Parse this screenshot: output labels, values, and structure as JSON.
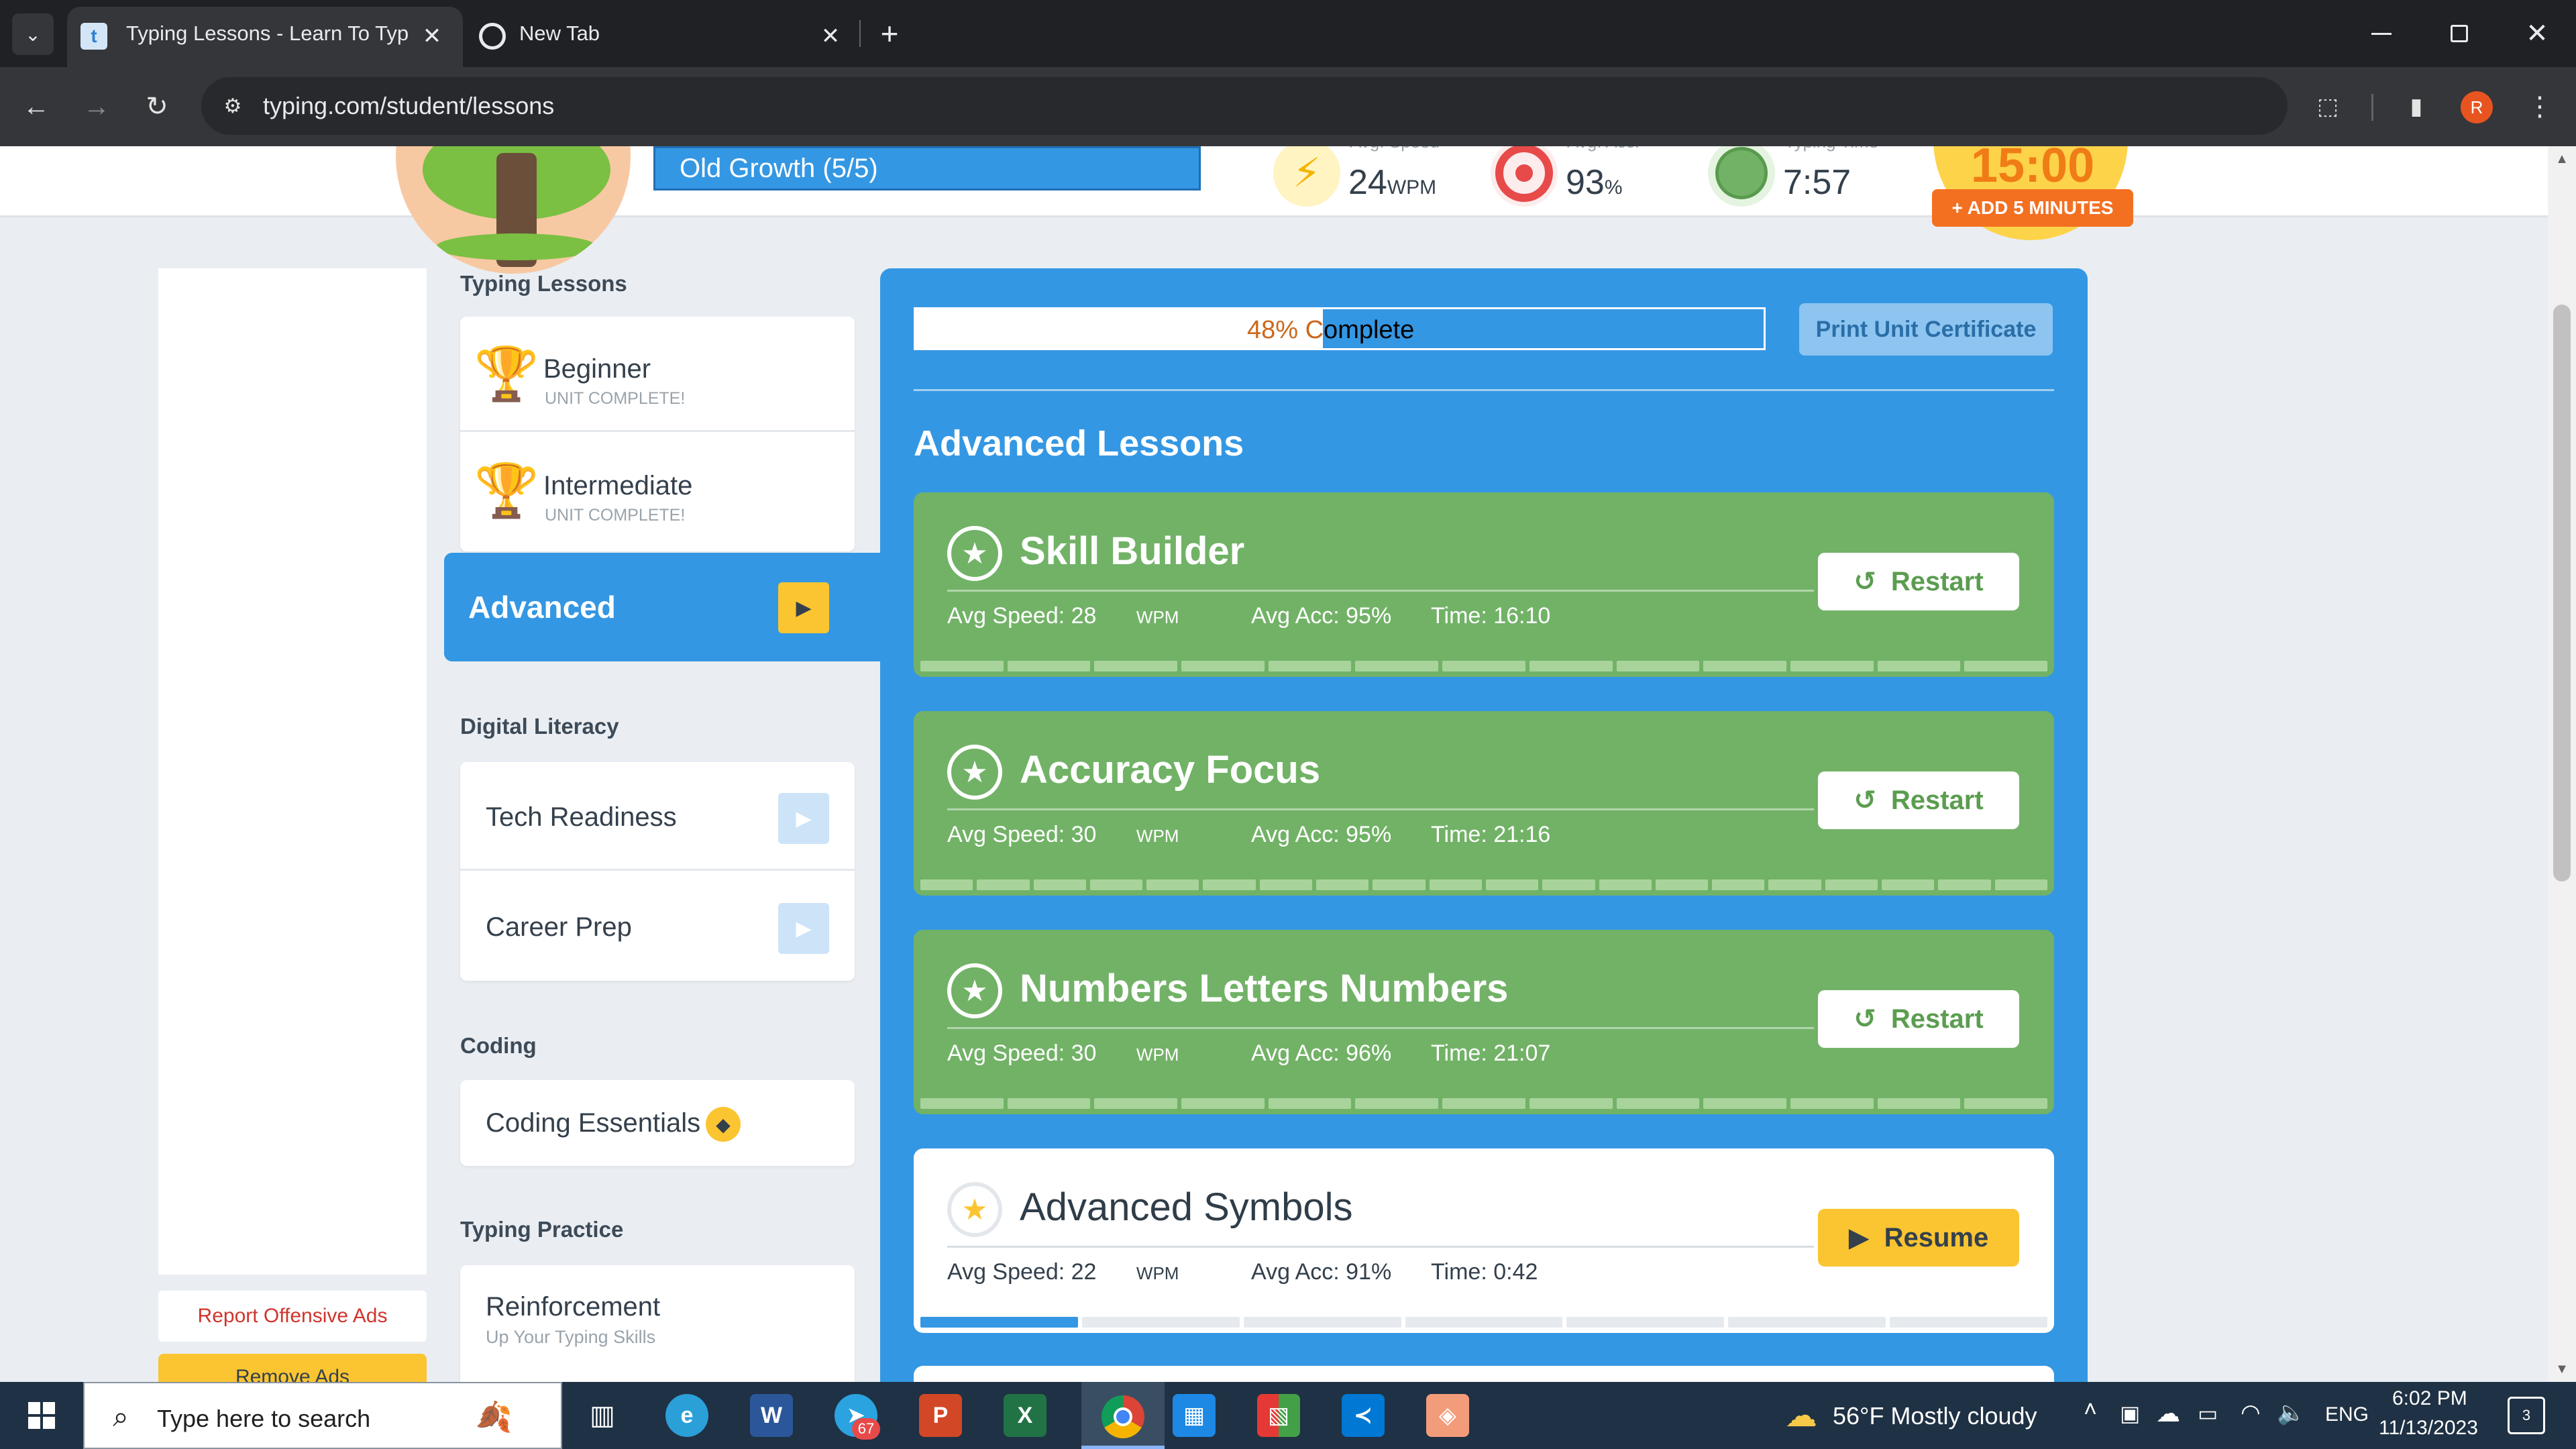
{
  "browser": {
    "tabs": [
      {
        "title": "Typing Lessons - Learn To Type",
        "active": true
      },
      {
        "title": "New Tab",
        "active": false
      }
    ],
    "url": "typing.com/student/lessons",
    "profile_initial": "R",
    "new_tab_glyph": "+",
    "tab_close_glyph": "✕"
  },
  "header": {
    "level_name": "Old Growth (5/5)",
    "stats": [
      {
        "label": "Avg. Speed",
        "value": "24",
        "unit": "WPM",
        "icon": "lightning-icon"
      },
      {
        "label": "Avg. Acc.",
        "value": "93",
        "unit": "%",
        "icon": "target-icon"
      },
      {
        "label": "Typing Time",
        "value": "7:57",
        "unit": "",
        "icon": "clock-icon"
      }
    ],
    "timer": "15:00",
    "add_minutes_label": "+ ADD 5 MINUTES"
  },
  "sidebar": {
    "report_ads_label": "Report Offensive Ads",
    "remove_ads_label": "Remove Ads",
    "sections": {
      "typing_lessons": "Typing Lessons",
      "digital_literacy": "Digital Literacy",
      "coding": "Coding",
      "typing_practice": "Typing Practice"
    },
    "lessons": {
      "beginner": {
        "title": "Beginner",
        "sub": "UNIT COMPLETE!"
      },
      "intermediate": {
        "title": "Intermediate",
        "sub": "UNIT COMPLETE!"
      },
      "advanced": {
        "title": "Advanced"
      }
    },
    "digital_literacy": [
      {
        "title": "Tech Readiness"
      },
      {
        "title": "Career Prep"
      }
    ],
    "coding": {
      "title": "Coding Essentials"
    },
    "practice": {
      "title": "Reinforcement",
      "sub": "Up Your Typing Skills"
    }
  },
  "main": {
    "progress_label": "48% Complete",
    "progress_value": 0.48,
    "print_button": "Print Unit Certificate",
    "section_title": "Advanced Lessons",
    "lessons": [
      {
        "title": "Skill Builder",
        "speed": "Avg Speed: 28",
        "unit": "WPM",
        "acc": "Avg Acc: 95%",
        "time": "Time: 16:10",
        "button": "Restart",
        "status": "complete",
        "segments_total": 13,
        "segments_done": 13
      },
      {
        "title": "Accuracy Focus",
        "speed": "Avg Speed: 30",
        "unit": "WPM",
        "acc": "Avg Acc: 95%",
        "time": "Time: 21:16",
        "button": "Restart",
        "status": "complete",
        "segments_total": 20,
        "segments_done": 20
      },
      {
        "title": "Numbers Letters Numbers",
        "speed": "Avg Speed: 30",
        "unit": "WPM",
        "acc": "Avg Acc: 96%",
        "time": "Time: 21:07",
        "button": "Restart",
        "status": "complete",
        "segments_total": 13,
        "segments_done": 13
      },
      {
        "title": "Advanced Symbols",
        "speed": "Avg Speed: 22",
        "unit": "WPM",
        "acc": "Avg Acc: 91%",
        "time": "Time: 0:42",
        "button": "Resume",
        "status": "in-progress",
        "segments_total": 7,
        "segments_done": 1
      }
    ]
  },
  "taskbar": {
    "search_placeholder": "Type here to search",
    "telegram_badge": "67",
    "weather": "56°F  Mostly cloudy",
    "language": "ENG",
    "time": "6:02 PM",
    "date": "11/13/2023",
    "notifications": "3"
  },
  "colors": {
    "panel_blue": "#3497e3",
    "lesson_green": "#72b267",
    "resume_yellow": "#fbc531",
    "timer_orange": "#f7a51e"
  }
}
